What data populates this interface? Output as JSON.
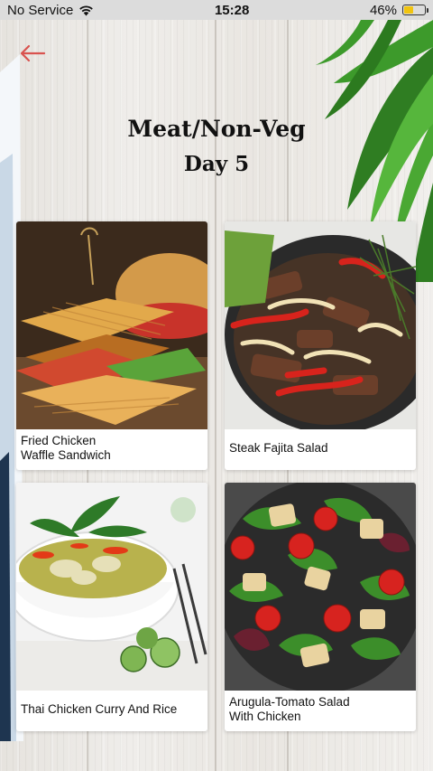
{
  "status_bar": {
    "carrier": "No Service",
    "time": "15:28",
    "battery_percent": "46%",
    "battery_level": 0.46,
    "icons": [
      "wifi-icon",
      "battery-icon"
    ]
  },
  "header": {
    "back_icon": "arrow-left-icon",
    "back_color": "#d9534f",
    "title": "Meat/Non-Veg",
    "subtitle": "Day 5"
  },
  "recipes": [
    {
      "name": "Fried Chicken\nWaffle Sandwich"
    },
    {
      "name": "Steak Fajita Salad"
    },
    {
      "name": "Thai Chicken Curry And Rice"
    },
    {
      "name": "Arugula-Tomato Salad\nWith Chicken"
    }
  ]
}
